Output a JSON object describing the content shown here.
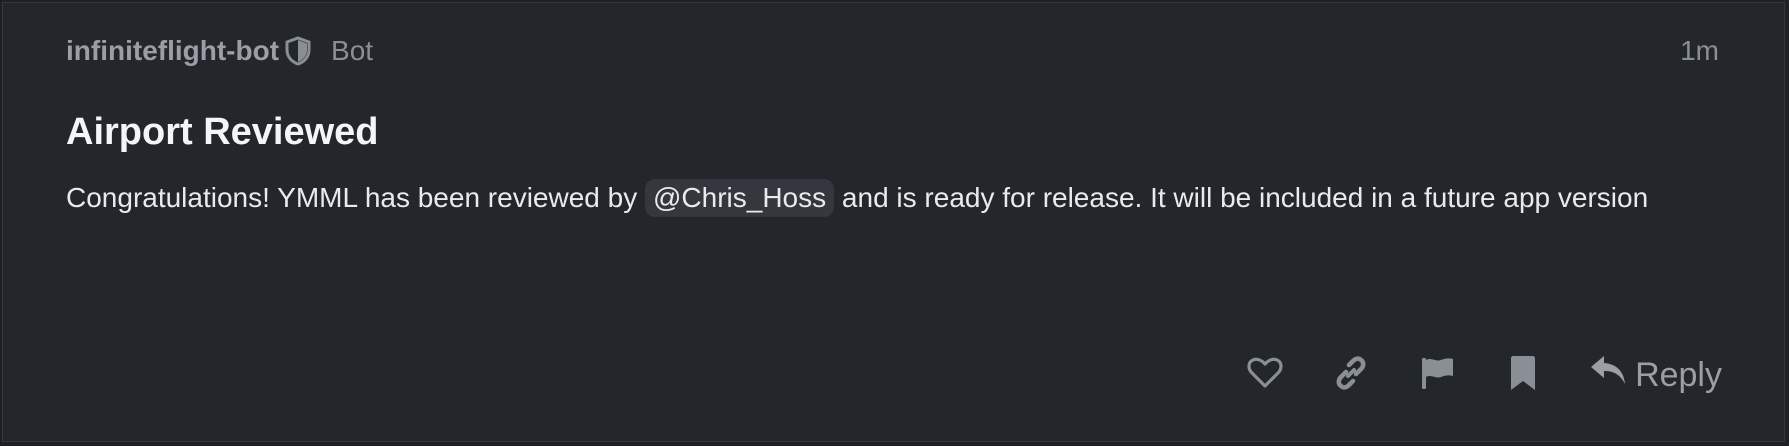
{
  "post": {
    "author": "infiniteflight-bot",
    "author_badge": "Bot",
    "timestamp": "1m",
    "title": "Airport Reviewed",
    "body_before": "Congratulations! YMML has been reviewed by ",
    "mention": "@Chris_Hoss",
    "body_after": " and is ready for release. It will be included in a future app version"
  },
  "actions": {
    "icons": [
      "heart-icon",
      "link-icon",
      "flag-icon",
      "bookmark-icon",
      "reply-icon"
    ],
    "reply_label": "Reply"
  },
  "colors": {
    "background": "#23262b",
    "text": "#e9eaec",
    "muted": "#8a8e95",
    "mention_bg": "#34373d"
  }
}
